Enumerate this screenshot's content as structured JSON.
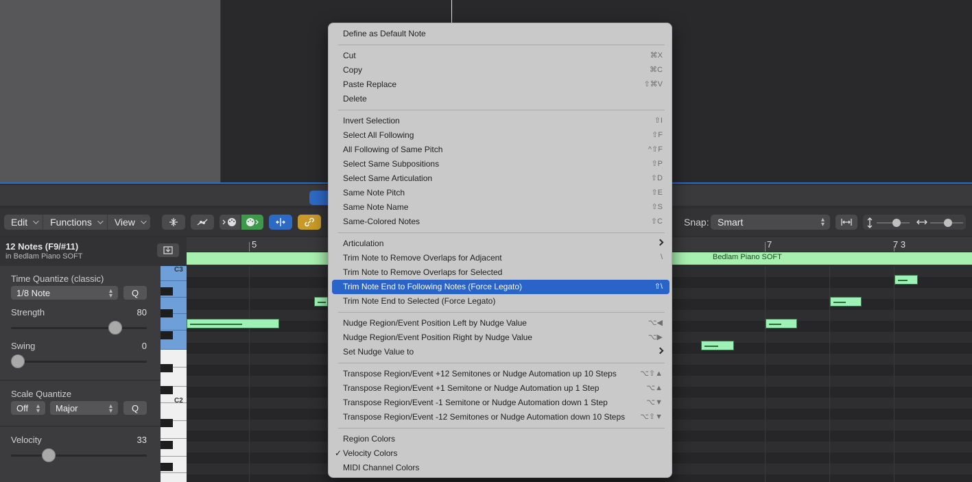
{
  "toolbar": {
    "edit_label": "Edit",
    "functions_label": "Functions",
    "view_label": "View",
    "snap_label": "Snap:",
    "snap_value": "Smart"
  },
  "inspector": {
    "title": "12 Notes (F9/#11)",
    "subtitle": "in Bedlam Piano SOFT",
    "time_quantize_label": "Time Quantize (classic)",
    "time_quantize_value": "1/8 Note",
    "q_label": "Q",
    "strength_label": "Strength",
    "strength_value": "80",
    "swing_label": "Swing",
    "swing_value": "0",
    "scale_quantize_label": "Scale Quantize",
    "scale_off": "Off",
    "scale_mode": "Major",
    "velocity_label": "Velocity",
    "velocity_value": "33"
  },
  "keyboard": {
    "c3": "C3",
    "c2": "C2"
  },
  "ruler": {
    "mark_5": "5",
    "mark_7": "7",
    "mark_73": "7 3"
  },
  "region": {
    "name": "Bedlam Piano SOFT"
  },
  "context_menu": {
    "items": [
      {
        "label": "Define as Default Note",
        "shortcut": ""
      },
      {
        "label": "Cut",
        "shortcut": "⌘X"
      },
      {
        "label": "Copy",
        "shortcut": "⌘C"
      },
      {
        "label": "Paste Replace",
        "shortcut": "⇧⌘V"
      },
      {
        "label": "Delete",
        "shortcut": ""
      },
      {
        "label": "Invert Selection",
        "shortcut": "⇧I"
      },
      {
        "label": "Select All Following",
        "shortcut": "⇧F"
      },
      {
        "label": "All Following of Same Pitch",
        "shortcut": "^⇧F"
      },
      {
        "label": "Select Same Subpositions",
        "shortcut": "⇧P"
      },
      {
        "label": "Select Same Articulation",
        "shortcut": "⇧D"
      },
      {
        "label": "Same Note Pitch",
        "shortcut": "⇧E"
      },
      {
        "label": "Same Note Name",
        "shortcut": "⇧S"
      },
      {
        "label": "Same-Colored Notes",
        "shortcut": "⇧C"
      },
      {
        "label": "Articulation",
        "shortcut": ""
      },
      {
        "label": "Trim Note to Remove Overlaps for Adjacent",
        "shortcut": "\\"
      },
      {
        "label": "Trim Note to Remove Overlaps for Selected",
        "shortcut": ""
      },
      {
        "label": "Trim Note End to Following Notes (Force Legato)",
        "shortcut": "⇧\\"
      },
      {
        "label": "Trim Note End to Selected (Force Legato)",
        "shortcut": ""
      },
      {
        "label": "Nudge Region/Event Position Left by Nudge Value",
        "shortcut": "⌥◀"
      },
      {
        "label": "Nudge Region/Event Position Right by Nudge Value",
        "shortcut": "⌥▶"
      },
      {
        "label": "Set Nudge Value to",
        "shortcut": ""
      },
      {
        "label": "Transpose Region/Event +12 Semitones or Nudge Automation up 10 Steps",
        "shortcut": "⌥⇧▲"
      },
      {
        "label": "Transpose Region/Event +1 Semitone or Nudge Automation up 1 Step",
        "shortcut": "⌥▲"
      },
      {
        "label": "Transpose Region/Event -1 Semitone or Nudge Automation down 1 Step",
        "shortcut": "⌥▼"
      },
      {
        "label": "Transpose Region/Event -12 Semitones or Nudge Automation down 10 Steps",
        "shortcut": "⌥⇧▼"
      },
      {
        "label": "Region Colors",
        "shortcut": ""
      },
      {
        "label": "Velocity Colors",
        "shortcut": ""
      },
      {
        "label": "MIDI Channel Colors",
        "shortcut": ""
      }
    ],
    "highlighted_index": 16,
    "checked_index": 26
  },
  "colors": {
    "accent": "#2a64c8",
    "note_fill": "#9ef2b5",
    "region_bar": "#a8f0b0"
  }
}
